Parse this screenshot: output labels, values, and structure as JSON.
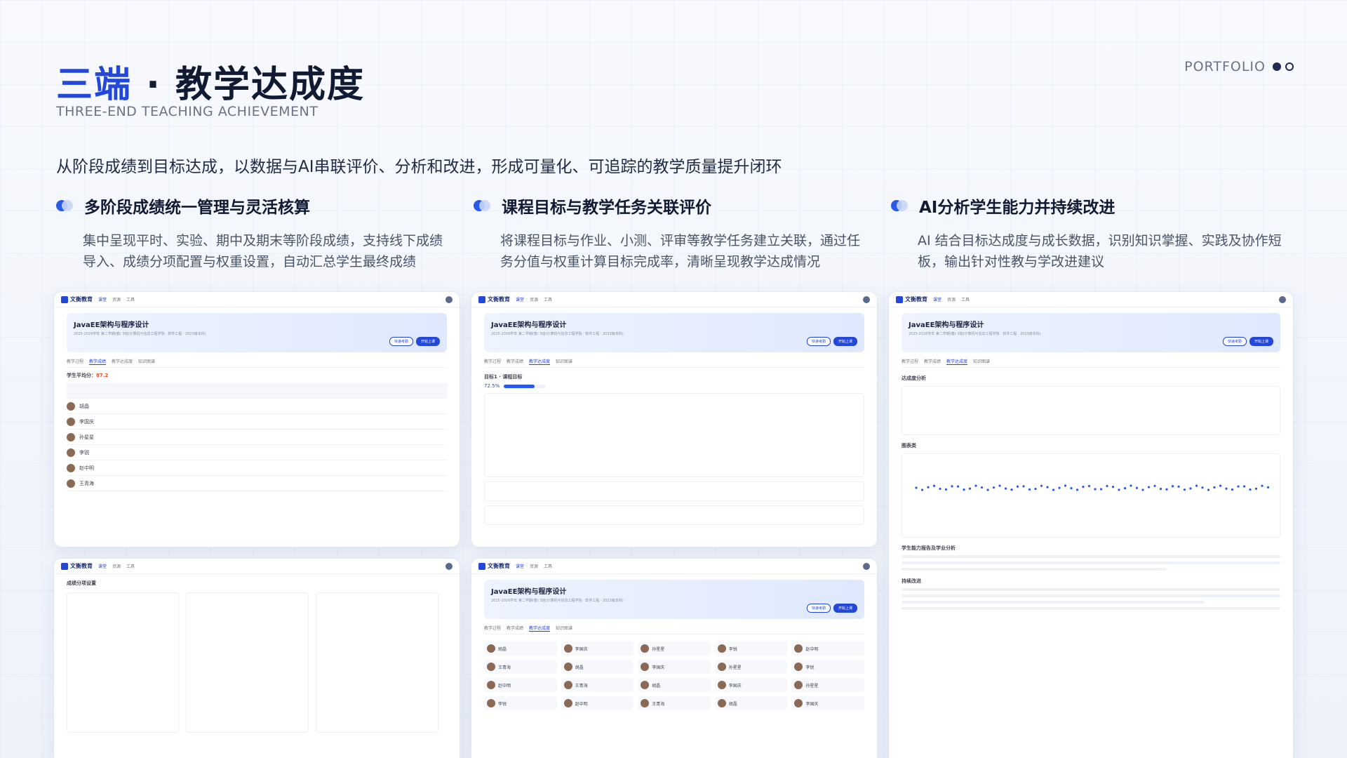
{
  "header": {
    "title_accent": "三端",
    "title_sep": " · ",
    "title_main": "教学达成度",
    "subtitle": "THREE-END TEACHING ACHIEVEMENT",
    "portfolio": "PORTFOLIO"
  },
  "lead": "从阶段成绩到目标达成，以数据与AI串联评价、分析和改进，形成可量化、可追踪的教学质量提升闭环",
  "features": [
    {
      "title": "多阶段成绩统一管理与灵活核算",
      "desc": "集中呈现平时、实验、期中及期末等阶段成绩，支持线下成绩导入、成绩分项配置与权重设置，自动汇总学生最终成绩"
    },
    {
      "title": "课程目标与教学任务关联评价",
      "desc": "将课程目标与作业、小测、评审等教学任务建立关联，通过任务分值与权重计算目标完成率，清晰呈现教学达成情况"
    },
    {
      "title": "AI分析学生能力并持续改进",
      "desc": "AI 结合目标达成度与成长数据，识别知识掌握、实践及协作短板，输出针对性教与学改进建议"
    }
  ],
  "app": {
    "logo": "文衡教育",
    "nav": [
      "课堂",
      "资源",
      "工具"
    ],
    "course_name": "JavaEE架构与程序设计",
    "course_meta": "2025-2026学年 第二学期(春)  3班(计算机与信息工程学院 · 软件工程 · 2023级本科)",
    "btn_quick": "快速考勤",
    "btn_start": "开始上课",
    "tabs": [
      "教学过程",
      "教学成绩",
      "教学达成度",
      "知识图谱"
    ],
    "score_label": "学生平均分：",
    "score_value": "87.2",
    "goal_label": "目标1 · 课程目标",
    "goal_rate": "72.5%",
    "analysis_title": "达成度分析",
    "chart_title": "图表类",
    "ability_title": "学生能力报告及学业分析",
    "improve_title": "持续改进",
    "grade_setting": "成绩分项设置",
    "students": [
      "胡晶",
      "李国庆",
      "孙星星",
      "李锐",
      "赵中明",
      "王青海"
    ]
  }
}
